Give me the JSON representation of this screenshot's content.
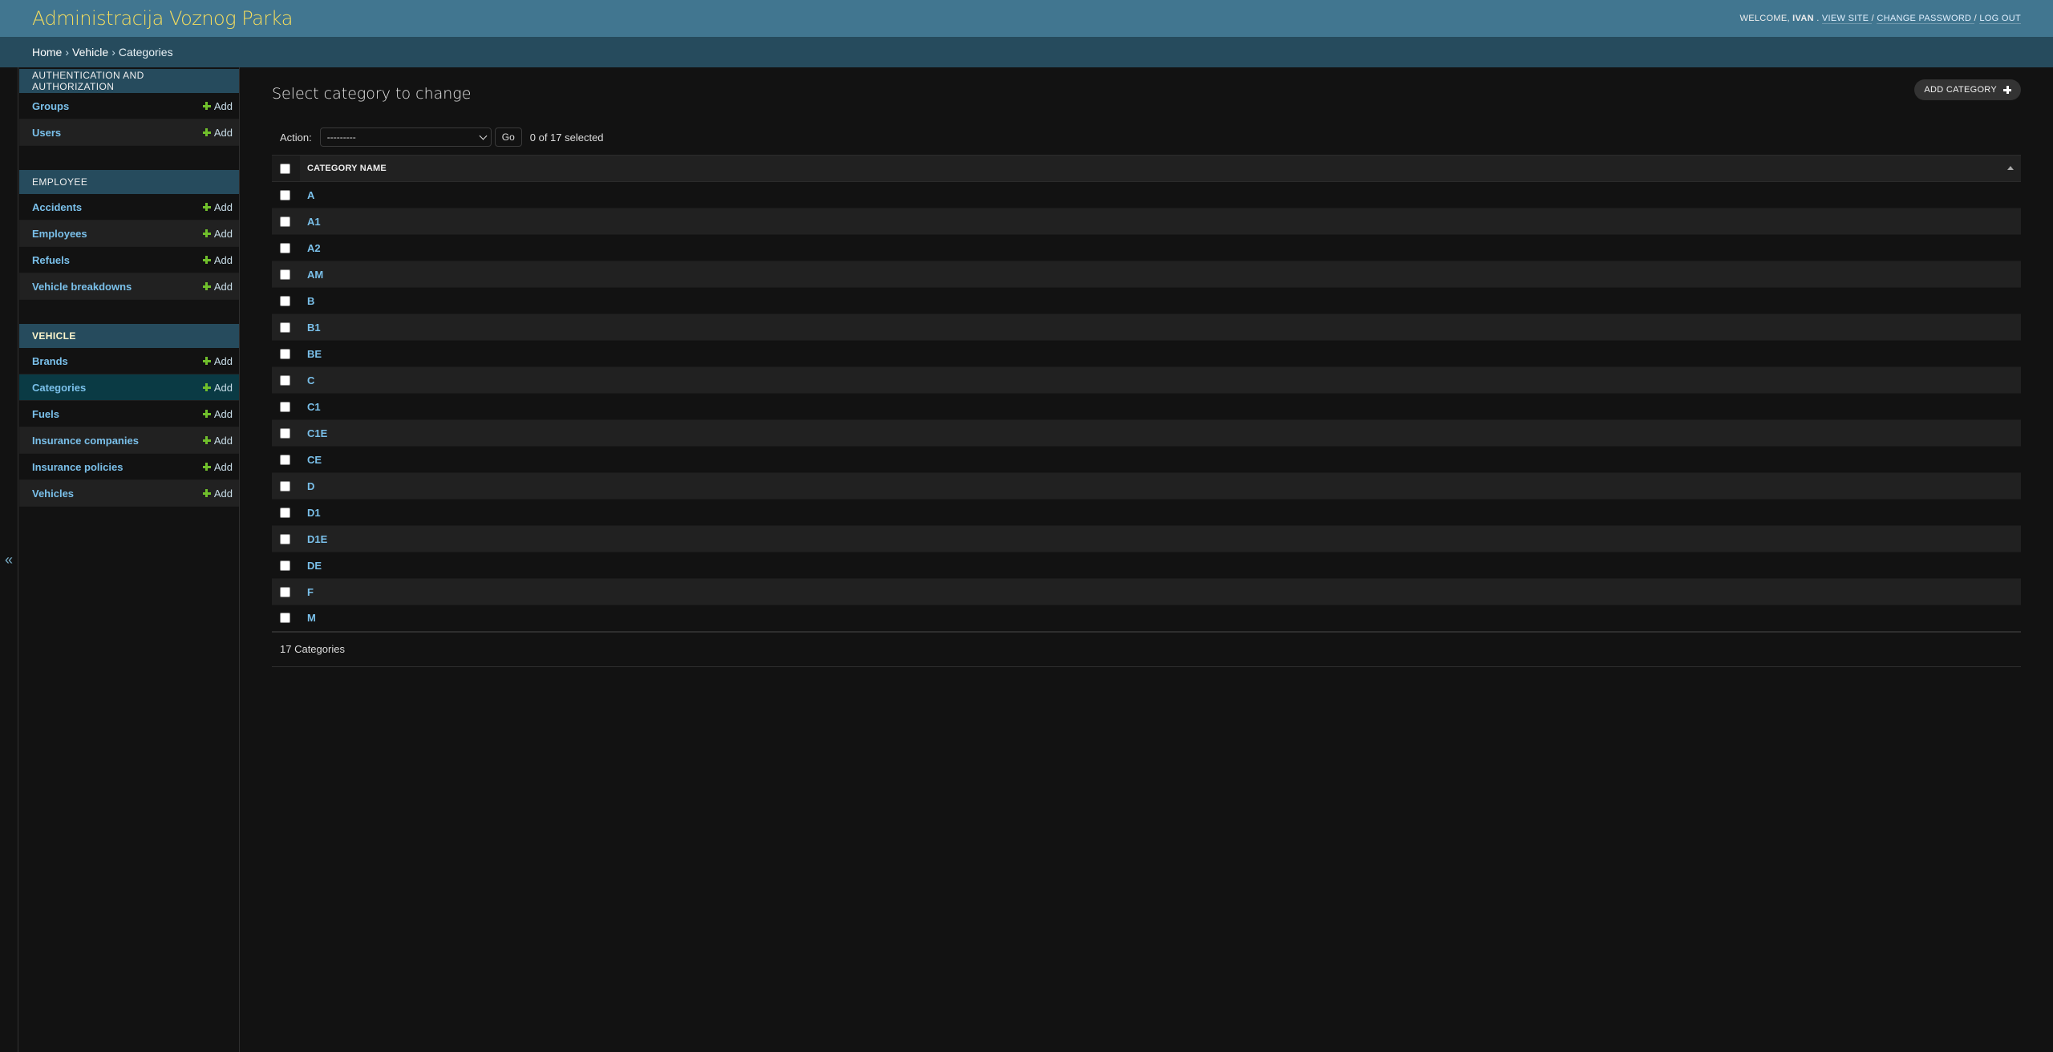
{
  "header": {
    "site_name": "Administracija Voznog Parka",
    "welcome_prefix": "Welcome,",
    "username": "Ivan",
    "view_site": "View site",
    "change_password": "Change password",
    "log_out": "Log out",
    "separator": "/"
  },
  "breadcrumbs": {
    "home": "Home",
    "app": "Vehicle",
    "current": "Categories",
    "separator": "›"
  },
  "sidebar": {
    "toggle_icon": "«",
    "modules": [
      {
        "caption": "Authentication and Authorization",
        "items": [
          {
            "label": "Groups",
            "add": "Add"
          },
          {
            "label": "Users",
            "add": "Add"
          }
        ]
      },
      {
        "caption": "Employee",
        "items": [
          {
            "label": "Accidents",
            "add": "Add"
          },
          {
            "label": "Employees",
            "add": "Add"
          },
          {
            "label": "Refuels",
            "add": "Add"
          },
          {
            "label": "Vehicle breakdowns",
            "add": "Add"
          }
        ]
      },
      {
        "caption": "Vehicle",
        "items": [
          {
            "label": "Brands",
            "add": "Add"
          },
          {
            "label": "Categories",
            "add": "Add"
          },
          {
            "label": "Fuels",
            "add": "Add"
          },
          {
            "label": "Insurance companies",
            "add": "Add"
          },
          {
            "label": "Insurance policies",
            "add": "Add"
          },
          {
            "label": "Vehicles",
            "add": "Add"
          }
        ]
      }
    ]
  },
  "content": {
    "title": "Select category to change",
    "add_button": "Add category",
    "action_label": "Action:",
    "action_selected": "---------",
    "go_button": "Go",
    "selection_counter": "0 of 17 selected",
    "column_header": "Category name",
    "rows": [
      "A",
      "A1",
      "A2",
      "AM",
      "B",
      "B1",
      "BE",
      "C",
      "C1",
      "C1E",
      "CE",
      "D",
      "D1",
      "D1E",
      "DE",
      "F",
      "M"
    ],
    "paginator": "17 Categories"
  },
  "colors": {
    "header_bg": "#417690",
    "breadcrumbs_bg": "#264b5d",
    "site_name": "#f5dd5d",
    "link": "#7ac0ea",
    "add_icon": "#70bf2b",
    "current_nav_bg": "#0a3a44"
  }
}
